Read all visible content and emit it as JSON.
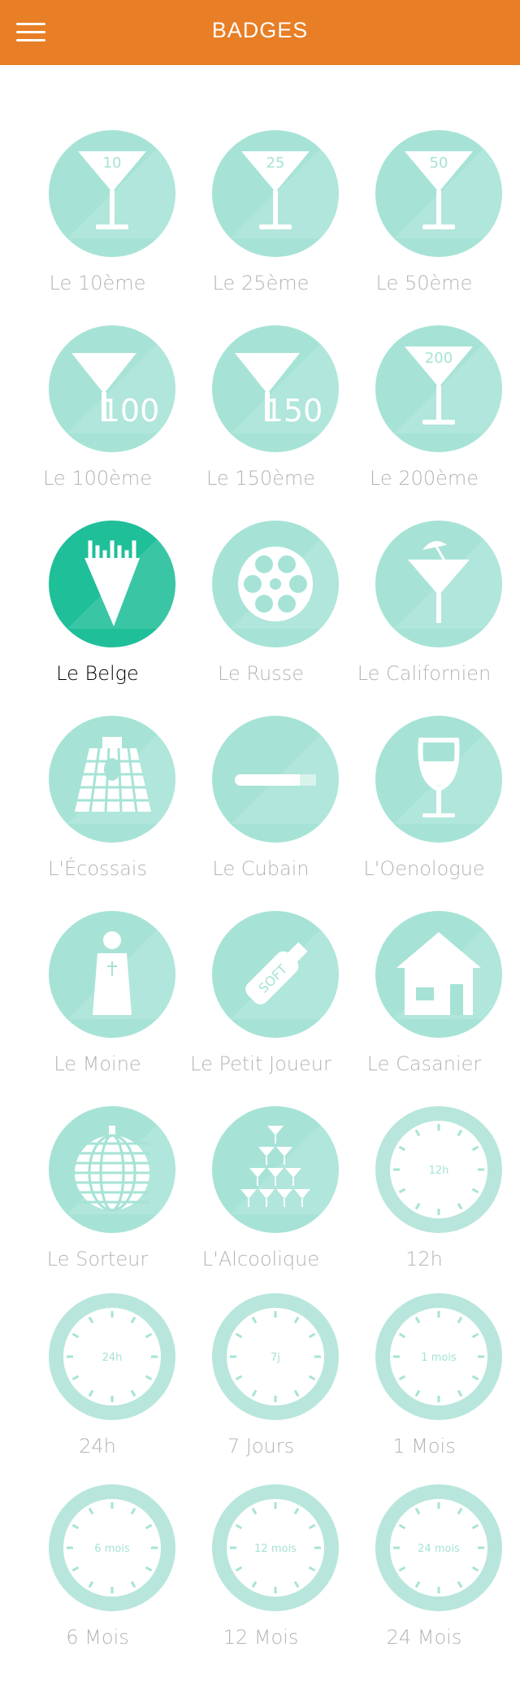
{
  "header": {
    "title": "BADGES",
    "menu_icon": "hamburger-menu-icon",
    "background": "#E87E25"
  },
  "colors": {
    "locked": "#A6E3D6",
    "unlocked": "#1FBF99",
    "label_locked": "#b4b4b4",
    "label_unlocked": "#000000"
  },
  "badges": [
    {
      "label": "Le 10ème",
      "icon": "martini-glass-10-icon",
      "glass_text": "10",
      "unlocked": false
    },
    {
      "label": "Le 25ème",
      "icon": "martini-glass-25-icon",
      "glass_text": "25",
      "unlocked": false
    },
    {
      "label": "Le 50ème",
      "icon": "martini-glass-50-icon",
      "glass_text": "50",
      "unlocked": false
    },
    {
      "label": "Le 100ème",
      "icon": "martini-glass-100-icon",
      "glass_text": "100",
      "unlocked": false
    },
    {
      "label": "Le 150ème",
      "icon": "martini-glass-150-icon",
      "glass_text": "150",
      "unlocked": false
    },
    {
      "label": "Le 200ème",
      "icon": "martini-glass-200-icon",
      "glass_text": "200",
      "unlocked": false
    },
    {
      "label": "Le Belge",
      "icon": "fries-cone-icon",
      "unlocked": true
    },
    {
      "label": "Le Russe",
      "icon": "revolver-cylinder-icon",
      "unlocked": false
    },
    {
      "label": "Le Californien",
      "icon": "cocktail-umbrella-icon",
      "unlocked": false
    },
    {
      "label": "L'Écossais",
      "icon": "tartan-kilt-icon",
      "unlocked": false
    },
    {
      "label": "Le Cubain",
      "icon": "cigar-icon",
      "unlocked": false
    },
    {
      "label": "L'Oenologue",
      "icon": "wine-glass-icon",
      "unlocked": false
    },
    {
      "label": "Le Moine",
      "icon": "monk-icon",
      "unlocked": false
    },
    {
      "label": "Le Petit Joueur",
      "icon": "soft-drink-bottle-icon",
      "bottle_text": "SOFT",
      "unlocked": false
    },
    {
      "label": "Le Casanier",
      "icon": "house-icon",
      "unlocked": false
    },
    {
      "label": "Le Sorteur",
      "icon": "disco-ball-icon",
      "unlocked": false
    },
    {
      "label": "L'Alcoolique",
      "icon": "glass-pyramid-icon",
      "unlocked": false
    },
    {
      "label": "12h",
      "icon": "clock-icon",
      "clock_text": "12h",
      "unlocked": false
    },
    {
      "label": "24h",
      "icon": "clock-icon",
      "clock_text": "24h",
      "unlocked": false
    },
    {
      "label": "7 Jours",
      "icon": "clock-icon",
      "clock_text": "7j",
      "unlocked": false
    },
    {
      "label": "1 Mois",
      "icon": "clock-icon",
      "clock_text": "1 mois",
      "unlocked": false
    },
    {
      "label": "6 Mois",
      "icon": "clock-icon",
      "clock_text": "6 mois",
      "unlocked": false
    },
    {
      "label": "12 Mois",
      "icon": "clock-icon",
      "clock_text": "12 mois",
      "unlocked": false
    },
    {
      "label": "24 Mois",
      "icon": "clock-icon",
      "clock_text": "24 mois",
      "unlocked": false
    }
  ]
}
